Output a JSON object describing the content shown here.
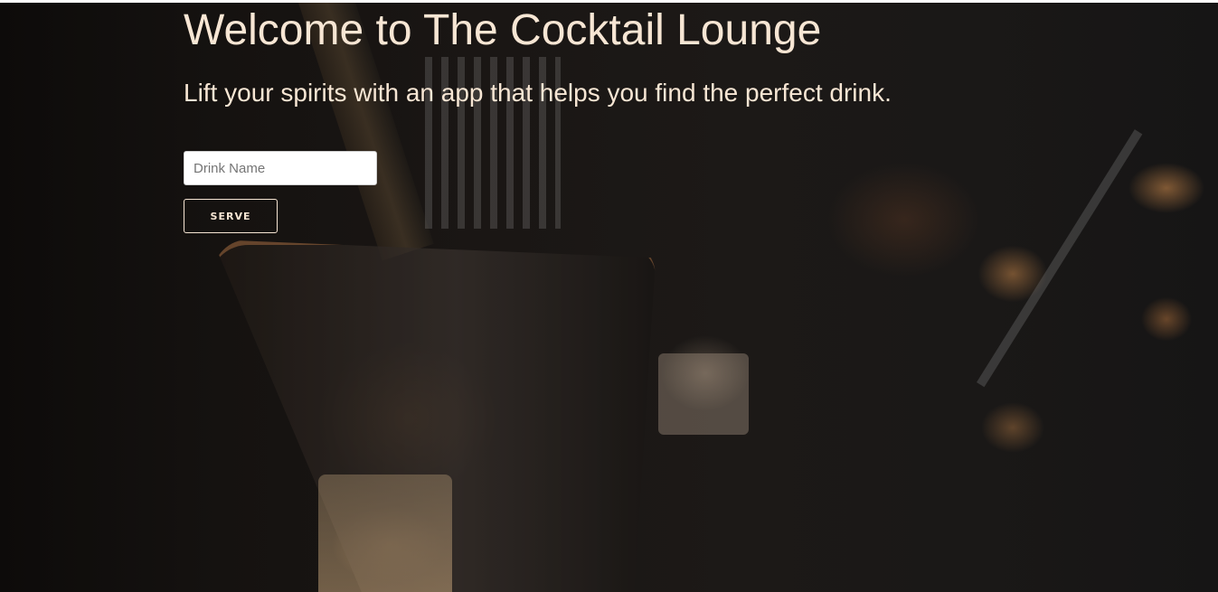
{
  "page": {
    "title": "Welcome to The Cocktail Lounge",
    "subtitle": "Lift your spirits with an app that helps you find the perfect drink."
  },
  "search": {
    "placeholder": "Drink Name",
    "value": ""
  },
  "actions": {
    "serve_label": "SERVE"
  },
  "colors": {
    "text": "#f7e6d4",
    "background": "#1a1614",
    "input_background": "#ffffff"
  }
}
